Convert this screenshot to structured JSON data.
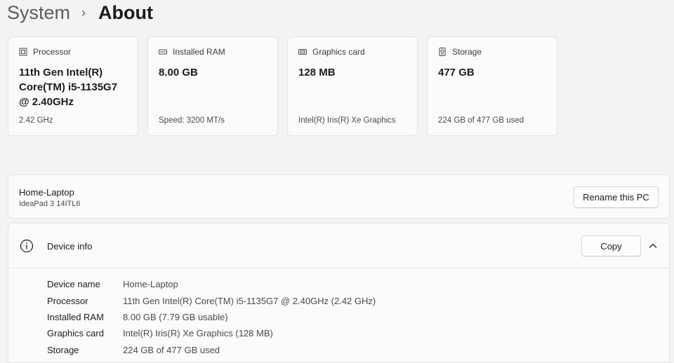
{
  "breadcrumb": {
    "parent": "System",
    "current": "About"
  },
  "specs": [
    {
      "icon": "processor-icon",
      "label": "Processor",
      "value": "11th Gen Intel(R) Core(TM) i5-1135G7 @ 2.40GHz",
      "sub": "2.42 GHz"
    },
    {
      "icon": "ram-icon",
      "label": "Installed RAM",
      "value": "8.00 GB",
      "sub": "Speed: 3200 MT/s"
    },
    {
      "icon": "graphics-card-icon",
      "label": "Graphics card",
      "value": "128 MB",
      "sub": "Intel(R) Iris(R) Xe Graphics"
    },
    {
      "icon": "storage-icon",
      "label": "Storage",
      "value": "477 GB",
      "sub": "224 GB of 477 GB used"
    }
  ],
  "pc": {
    "name": "Home-Laptop",
    "model": "IdeaPad 3 14ITL6",
    "rename_label": "Rename this PC"
  },
  "device_info": {
    "title": "Device info",
    "copy_label": "Copy",
    "rows": [
      {
        "label": "Device name",
        "value": "Home-Laptop"
      },
      {
        "label": "Processor",
        "value": "11th Gen Intel(R) Core(TM) i5-1135G7 @ 2.40GHz (2.42 GHz)"
      },
      {
        "label": "Installed RAM",
        "value": "8.00 GB (7.79 GB usable)"
      },
      {
        "label": "Graphics card",
        "value": "Intel(R) Iris(R) Xe Graphics (128 MB)"
      },
      {
        "label": "Storage",
        "value": "224 GB of 477 GB used"
      }
    ]
  }
}
